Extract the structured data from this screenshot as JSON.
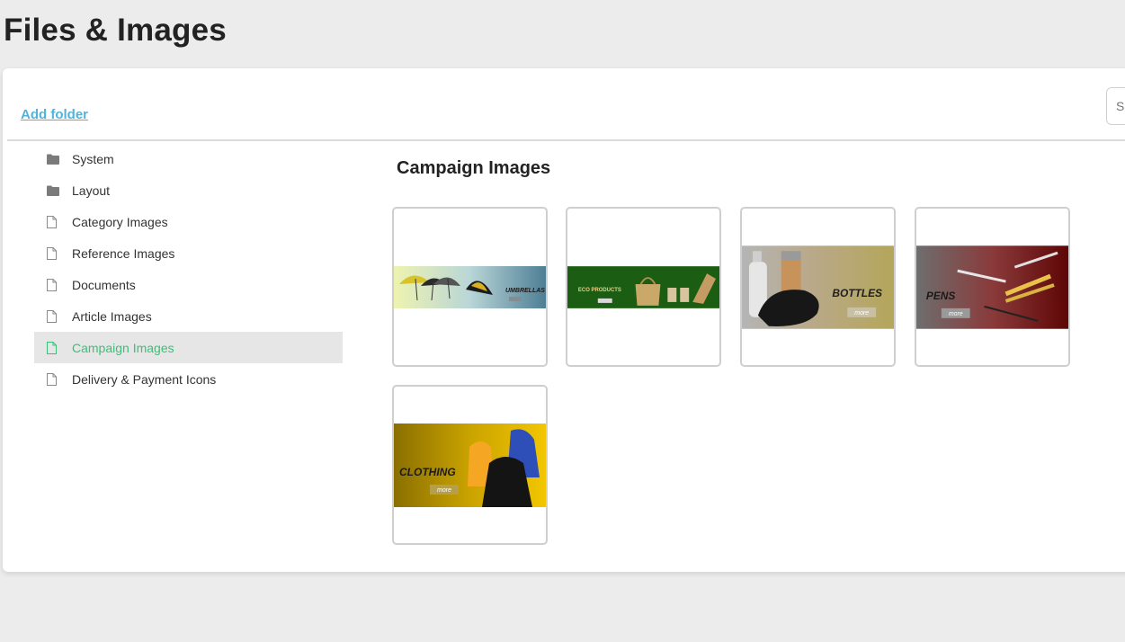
{
  "page": {
    "title": "Files & Images"
  },
  "toolbar": {
    "add_folder_label": "Add folder",
    "search_placeholder": "S"
  },
  "sidebar": {
    "items": [
      {
        "label": "System",
        "icon": "folder-icon",
        "active": false
      },
      {
        "label": "Layout",
        "icon": "folder-icon",
        "active": false
      },
      {
        "label": "Category Images",
        "icon": "file-icon",
        "active": false
      },
      {
        "label": "Reference Images",
        "icon": "file-icon",
        "active": false
      },
      {
        "label": "Documents",
        "icon": "file-icon",
        "active": false
      },
      {
        "label": "Article Images",
        "icon": "file-icon",
        "active": false
      },
      {
        "label": "Campaign Images",
        "icon": "file-icon",
        "active": true
      },
      {
        "label": "Delivery & Payment Icons",
        "icon": "file-icon",
        "active": false
      }
    ]
  },
  "main": {
    "title": "Campaign Images",
    "images": [
      {
        "name": "umbrellas-banner",
        "text": "UMBRELLAS",
        "more": "more"
      },
      {
        "name": "eco-products-banner",
        "text": "ECO PRODUCTS",
        "more": "more"
      },
      {
        "name": "bottles-banner",
        "text": "BOTTLES",
        "more": "more"
      },
      {
        "name": "pens-banner",
        "text": "PENS",
        "more": "more"
      },
      {
        "name": "clothing-banner",
        "text": "CLOTHING",
        "more": "more"
      }
    ]
  },
  "colors": {
    "accent_link": "#4fb3de",
    "active_item": "#3cbf78",
    "active_bg": "#e6e6e6"
  }
}
